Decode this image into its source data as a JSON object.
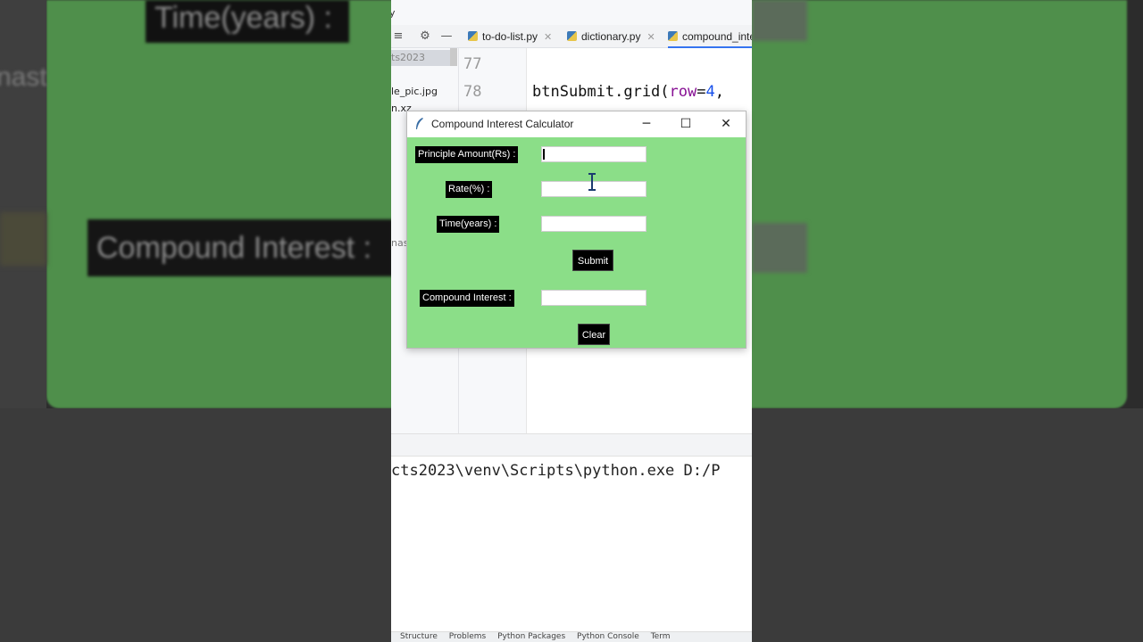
{
  "background": {
    "box_top_text": "Time(years) :",
    "box_mid_text": "Compound Interest :",
    "side_text": "nast"
  },
  "ide": {
    "title_fragment": "y",
    "tabs": [
      {
        "label": "to-do-list.py"
      },
      {
        "label": "dictionary.py"
      },
      {
        "label": "compound_inte"
      }
    ],
    "project_items": {
      "selected": "ts2023",
      "item1": "le_pic.jpg",
      "item2": "n.xz",
      "item3": "nast"
    },
    "line_numbers": [
      "77",
      "78"
    ],
    "code_line_78": {
      "fn": "btnSubmit.grid(",
      "kw": "row",
      "eq": "=",
      "num": "4",
      "rest": ","
    },
    "terminal_command": "cts2023\\venv\\Scripts\\python.exe D:/P",
    "bottom_tools": [
      "Structure",
      "Problems",
      "Python Packages",
      "Python Console",
      "Term"
    ]
  },
  "tk": {
    "title": "Compound Interest Calculator",
    "minimize": "─",
    "maximize": "☐",
    "close": "✕",
    "principal_label": "Principle Amount(Rs) :",
    "rate_label": "Rate(%) :",
    "time_label": "Time(years) :",
    "ci_label": "Compound Interest :",
    "submit_label": "Submit",
    "clear_label": "Clear",
    "principal_value": "",
    "rate_value": "",
    "time_value": "",
    "ci_value": "",
    "bg_color": "#8bde88"
  }
}
